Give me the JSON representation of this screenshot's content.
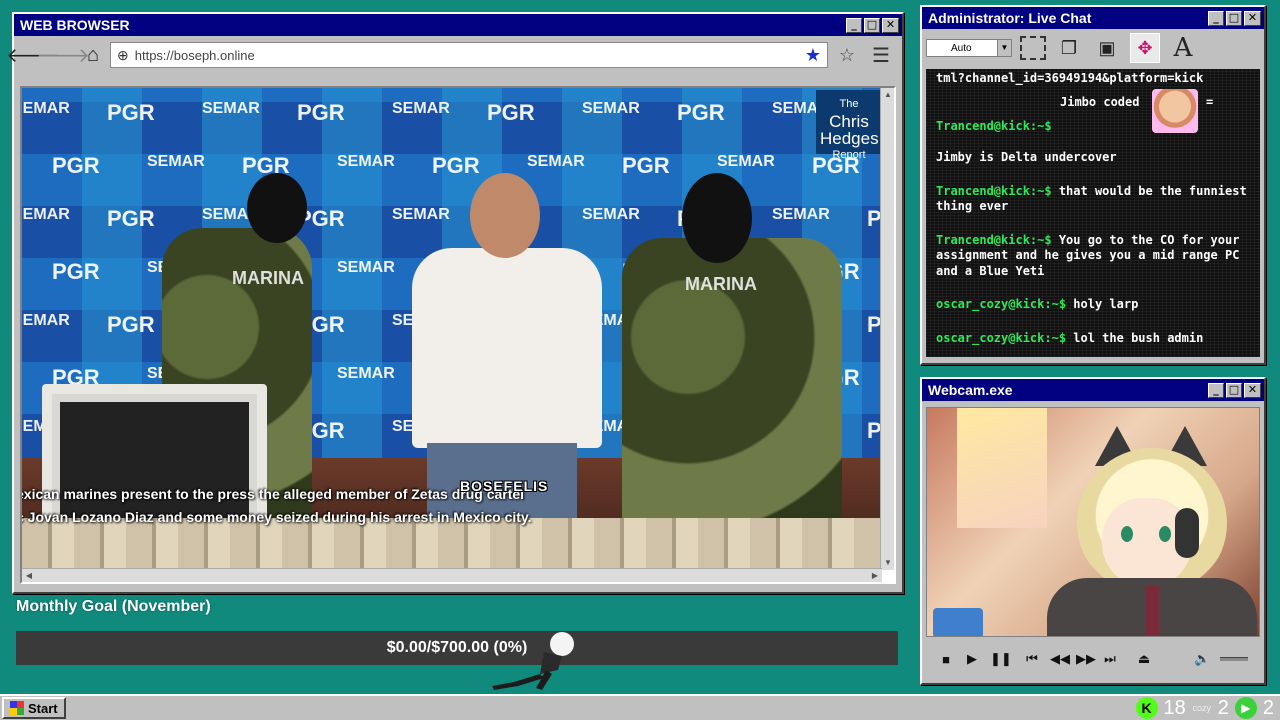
{
  "browser": {
    "title": "WEB BROWSER",
    "url": "https://boseph.online",
    "video": {
      "subtitle_line1": "exican marines present to the press the alleged member of Zetas drug cartel",
      "subtitle_line2": "c Jovan Lozano Diaz and some money seized during his arrest in Mexico city.",
      "logo_line1": "The",
      "logo_line2": "Chris",
      "logo_line3": "Hedges",
      "logo_line4": "Report",
      "backdrop_words": [
        "SEMAR",
        "PGR"
      ],
      "vest_label": "MARINA",
      "watermark": "BOSEFELIS"
    }
  },
  "chat": {
    "title": "Administrator: Live Chat",
    "font_size_select": "Auto",
    "messages": [
      {
        "user": "",
        "text": "tml?channel_id=36949194&platform=kick"
      },
      {
        "user": "",
        "text": "Jimbo coded",
        "suffix": "="
      },
      {
        "user": "Trancend@kick:~$",
        "text": ""
      },
      {
        "user": "",
        "text": "Jimby is Delta undercover"
      },
      {
        "user": "Trancend@kick:~$",
        "text": "that would be the funniest thing ever"
      },
      {
        "user": "Trancend@kick:~$",
        "text": "You go to the CO for your assignment and he gives you a mid range PC and a Blue Yeti"
      },
      {
        "user": "oscar_cozy@kick:~$",
        "text": "holy larp"
      },
      {
        "user": "oscar_cozy@kick:~$",
        "text": "lol the bush admin"
      }
    ]
  },
  "webcam": {
    "title": "Webcam.exe"
  },
  "goal": {
    "title": "Monthly Goal (November)",
    "text": "$0.00/$700.00 (0%)",
    "progress_fraction": 0
  },
  "taskbar": {
    "start_label": "Start",
    "kick_viewers": "18",
    "cozy_label": "cozy",
    "other_viewers": "2",
    "play_count": "2"
  },
  "colors": {
    "desktop": "#118a7e",
    "titlebar": "#000080",
    "chat_user": "#2ee85a",
    "bookmark_star": "#1a2fd0"
  }
}
